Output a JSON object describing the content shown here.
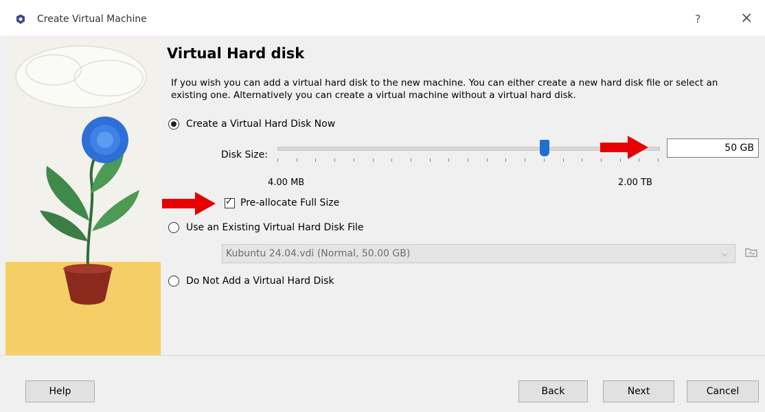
{
  "window": {
    "title": "Create Virtual Machine",
    "help_glyph": "?",
    "close_glyph": "×"
  },
  "page": {
    "heading": "Virtual Hard disk",
    "description": "If you wish you can add a virtual hard disk to the new machine. You can either create a new hard disk file or select an existing one. Alternatively you can create a virtual machine without a virtual hard disk."
  },
  "options": {
    "create_now": {
      "label": "Create a Virtual Hard Disk Now",
      "checked": true
    },
    "use_existing": {
      "label": "Use an Existing Virtual Hard Disk File",
      "checked": false
    },
    "do_not_add": {
      "label": "Do Not Add a Virtual Hard Disk",
      "checked": false
    }
  },
  "disk_size": {
    "label": "Disk Size:",
    "value_text": "50 GB",
    "min_label": "4.00 MB",
    "max_label": "2.00 TB",
    "slider_fraction": 0.7
  },
  "preallocate": {
    "label": "Pre-allocate Full Size",
    "checked": true
  },
  "existing_file": {
    "selected": "Kubuntu 24.04.vdi (Normal, 50.00 GB)",
    "chevron": "⌵"
  },
  "buttons": {
    "help": "Help",
    "back": "Back",
    "next": "Next",
    "cancel": "Cancel"
  },
  "colors": {
    "accent": "#1f6fd1",
    "annotation_arrow": "#e60000"
  },
  "icons": [
    "virtualbox-icon",
    "help-icon",
    "close-icon",
    "chevron-down-icon",
    "folder-icon",
    "arrow-right-annotation"
  ]
}
